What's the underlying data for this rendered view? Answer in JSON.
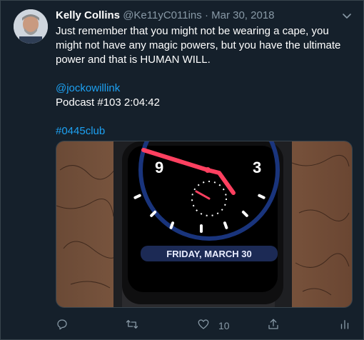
{
  "tweet": {
    "author_name": "Kelly Collins",
    "author_handle": "@Ke11yC011ins",
    "separator": "·",
    "date": "Mar 30, 2018",
    "text_line1": "Just remember that you might not be wearing a cape, you",
    "text_line2": "might not have any magic powers, but you have the ultimate",
    "text_line3": "power and that is HUMAN WILL.",
    "mention": "@jockowillink",
    "podcast_prefix": "Podcast #",
    "podcast_number": "103",
    "podcast_time": " 2:04:42",
    "hashtag": "#0445club"
  },
  "media": {
    "watch_numeral_left": "9",
    "watch_numeral_right": "3",
    "watch_date": "FRIDAY, MARCH 30"
  },
  "actions": {
    "reply_count": "",
    "retweet_count": "",
    "like_count": "10",
    "icons": [
      "reply-icon",
      "retweet-icon",
      "like-icon",
      "share-icon",
      "analytics-icon"
    ]
  }
}
